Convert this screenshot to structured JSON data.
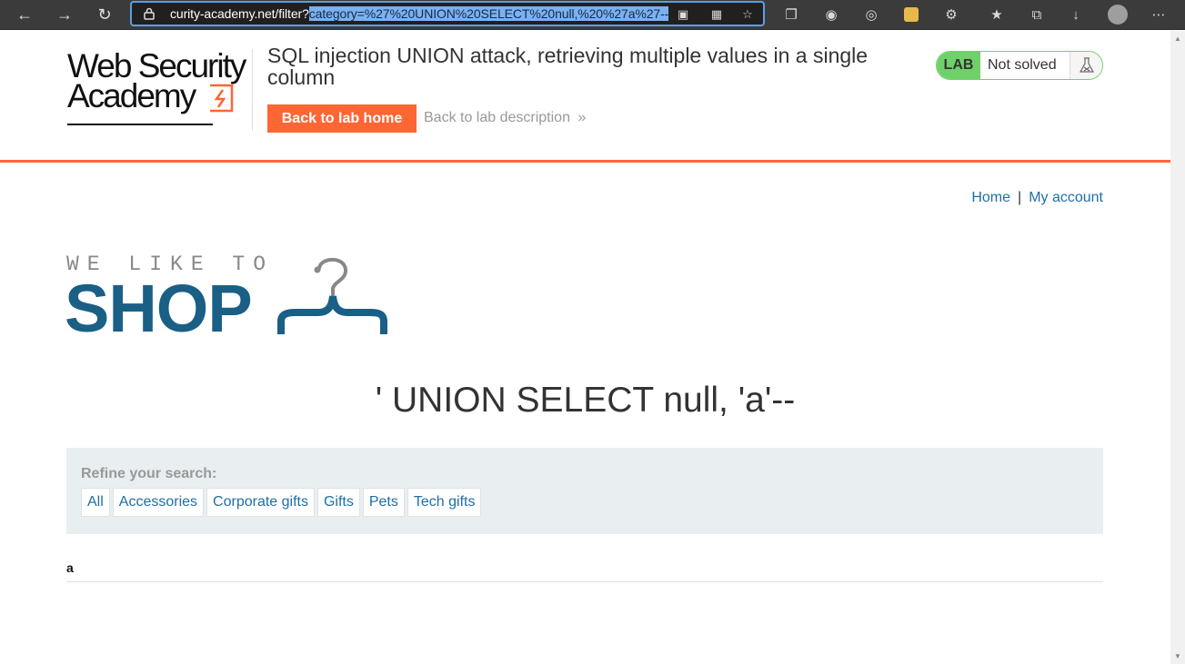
{
  "browser": {
    "url_prefix": "curity-academy.net/filter?",
    "url_selected": "category=%27%20UNION%20SELECT%20null,%20%27a%27--"
  },
  "lab": {
    "logo_line1": "Web Security",
    "logo_line2": "Academy",
    "title": "SQL injection UNION attack, retrieving multiple values in a single column",
    "back_home": "Back to lab home",
    "back_description": "Back to lab description",
    "badge_label": "LAB",
    "status": "Not solved"
  },
  "nav": {
    "home": "Home",
    "separator": "|",
    "account": "My account"
  },
  "shop_logo": {
    "tagline": "WE LIKE TO",
    "word": "SHOP"
  },
  "heading": "' UNION SELECT null, 'a'--",
  "filters": {
    "label": "Refine your search:",
    "categories": [
      "All",
      "Accessories",
      "Corporate gifts",
      "Gifts",
      "Pets",
      "Tech gifts"
    ]
  },
  "results": [
    "a"
  ],
  "colors": {
    "accent": "#ff6633",
    "lab_green": "#70d16b",
    "link_blue": "#1e6fa8",
    "shop_blue": "#1a5f85"
  }
}
